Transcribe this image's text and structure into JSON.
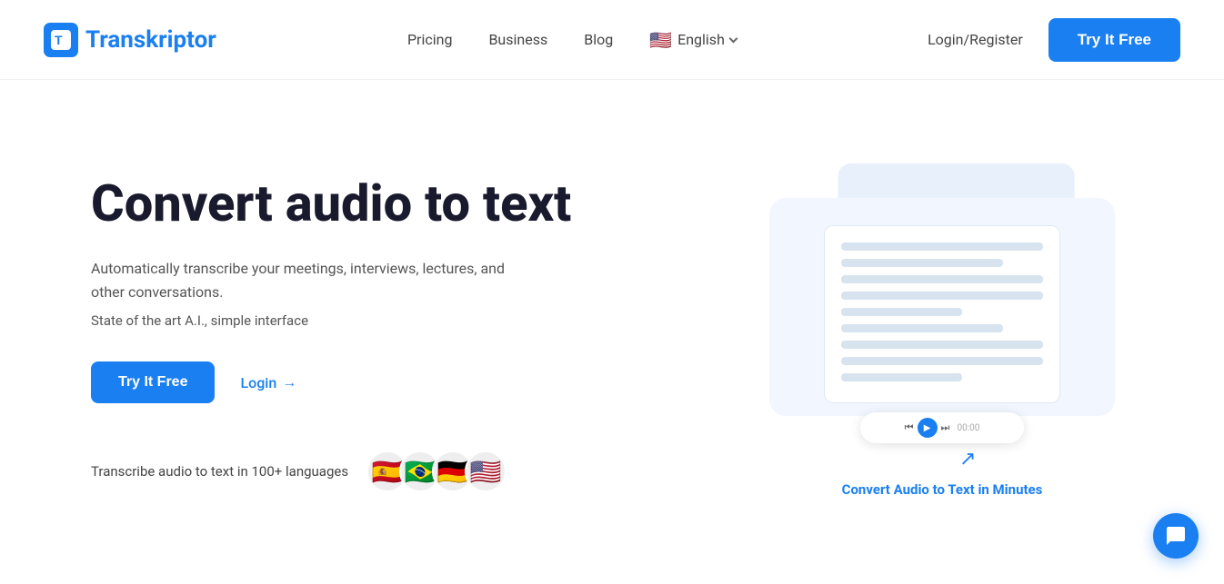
{
  "nav": {
    "logo_text_T": "T",
    "logo_text_rest": "ranskriptor",
    "links": [
      {
        "id": "pricing",
        "label": "Pricing"
      },
      {
        "id": "business",
        "label": "Business"
      },
      {
        "id": "blog",
        "label": "Blog"
      }
    ],
    "lang_flag": "🇺🇸",
    "lang_label": "English",
    "login_label": "Login/Register",
    "cta_label": "Try It Free"
  },
  "hero": {
    "title": "Convert audio to text",
    "desc": "Automatically transcribe your meetings, interviews, lectures, and other conversations.",
    "sub": "State of the art A.I., simple interface",
    "cta_label": "Try It Free",
    "login_label": "Login",
    "lang_text": "Transcribe audio to text in 100+ languages",
    "flags": [
      "🇪🇸",
      "🇧🇷",
      "🇩🇪",
      "🇺🇸"
    ],
    "illustration": {
      "convert_label": "Convert Audio to Text in Minutes"
    }
  },
  "chat": {
    "label": "chat-icon"
  }
}
